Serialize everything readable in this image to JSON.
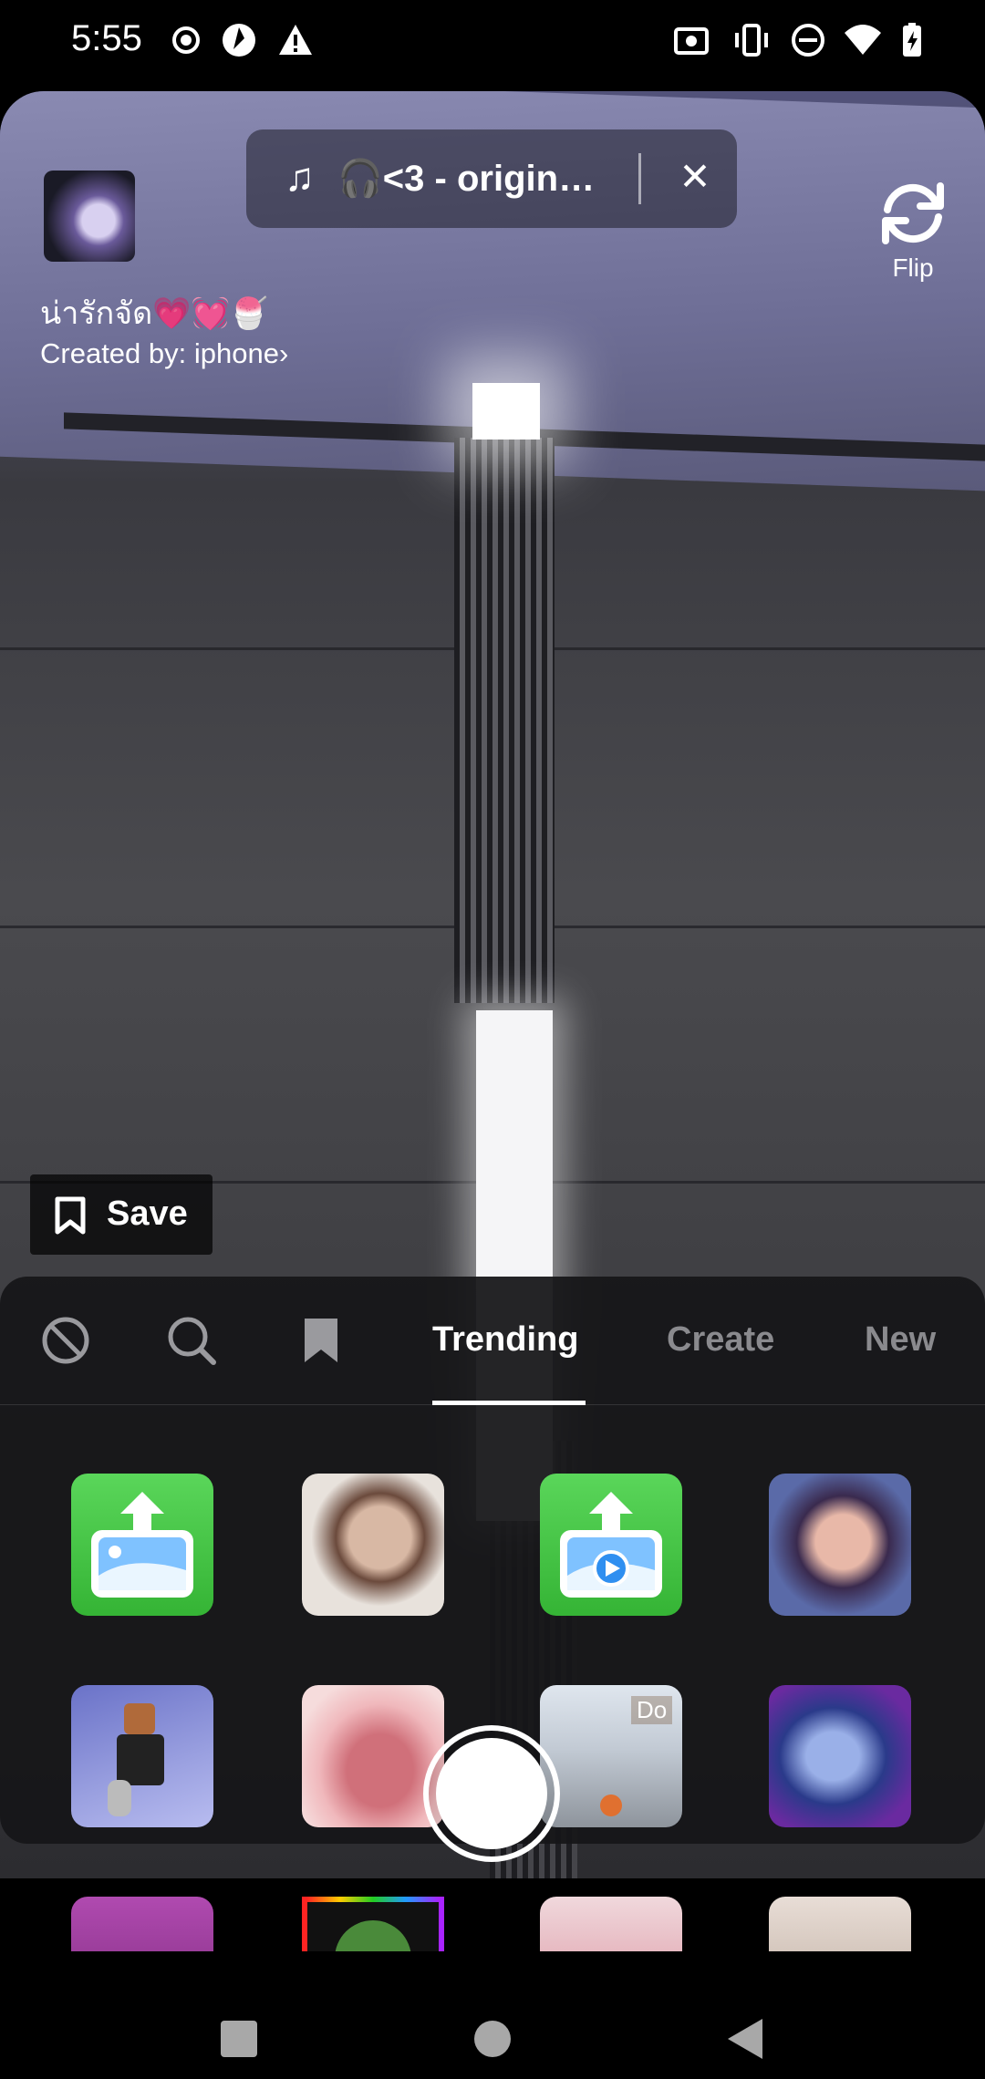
{
  "status_bar": {
    "time": "5:55",
    "left_icons": [
      "record-icon",
      "app-shutter-icon",
      "warning-icon"
    ],
    "right_icons": [
      "screenshot-icon",
      "vibrate-icon",
      "dnd-icon",
      "wifi-icon",
      "battery-charging-icon"
    ]
  },
  "effect": {
    "name": "น่ารักจัด💗💓🍧",
    "creator": "Created by: iphone",
    "creator_chevron": "›"
  },
  "music": {
    "note": "♫",
    "title": "🎧<3 - origina...",
    "close": "✕"
  },
  "flip": {
    "label": "Flip"
  },
  "save": {
    "label": "Save"
  },
  "tabs": [
    {
      "label": "Trending",
      "active": true
    },
    {
      "label": "Create",
      "active": false
    },
    {
      "label": "New",
      "active": false
    }
  ],
  "tab_icons": [
    "none-icon",
    "search-icon",
    "bookmark-icon"
  ],
  "effects_grid": {
    "row1": [
      "upload-photo-effect",
      "portrait-effect-1",
      "upload-video-effect",
      "portrait-effect-2"
    ],
    "row2": [
      "runner-game-effect",
      "lips-effect",
      "cloud-road-effect",
      "neon-portrait-effect"
    ],
    "row3": [
      "magenta-effect",
      "rainbow-watermelon-effect",
      "pink-lips-effect",
      "eyes-effect"
    ],
    "badge_text": "Do"
  },
  "colors": {
    "upload_green": "#35b435",
    "sheet_bg": "#161618"
  },
  "nav_bar": [
    "recents-icon",
    "home-icon",
    "back-icon"
  ]
}
